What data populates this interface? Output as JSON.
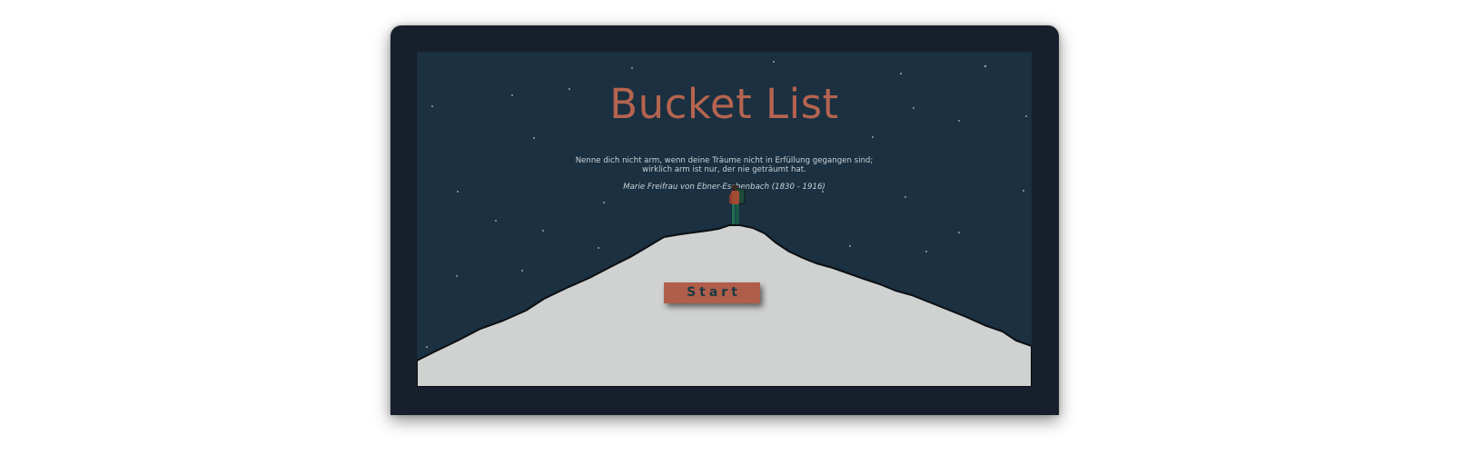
{
  "app": {
    "title": "Bucket List"
  },
  "quote": {
    "line1": "Nenne dich nicht arm, wenn deine Träume nicht in Erfüllung gegangen sind;",
    "line2": "wirklich arm ist nur, der nie geträumt hat.",
    "author": "Marie Freifrau von Ebner-Eschenbach (1830 - 1916)"
  },
  "actions": {
    "start_label": "Start"
  },
  "colors": {
    "device_frame": "#161f2b",
    "sky": "#1b3040",
    "title": "#b56450",
    "quote_text": "#c9d3da",
    "mountain": "#d0d2d1",
    "button": "#b05e4a",
    "button_text": "#1a3a44"
  },
  "icons": {
    "hiker": "hiker-with-backpack",
    "stars": "star-dots"
  }
}
